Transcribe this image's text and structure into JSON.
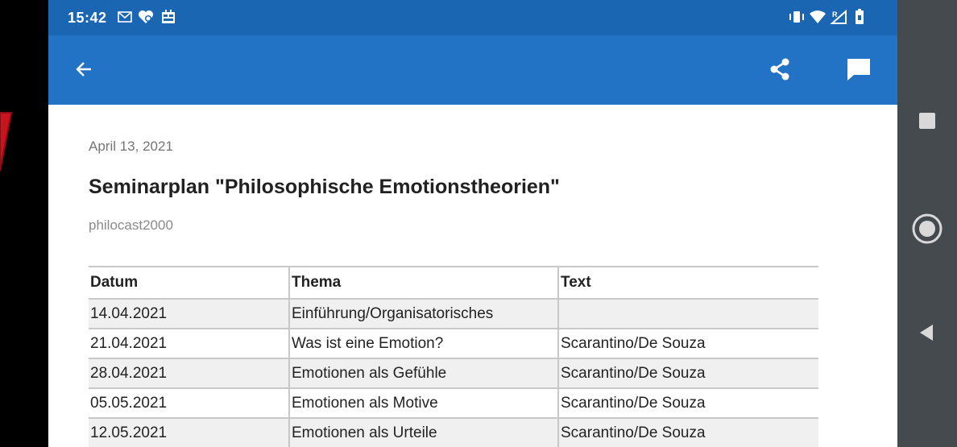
{
  "status_bar": {
    "time": "15:42",
    "left_icons": [
      "gmail-icon",
      "heart-notification-icon",
      "app-notification-icon"
    ],
    "right_icons": [
      "vibrate-icon",
      "wifi-icon",
      "signal-roaming-icon",
      "battery-icon"
    ]
  },
  "app_bar": {
    "back_icon": "arrow-left-icon",
    "share_icon": "share-icon",
    "comment_icon": "comment-icon",
    "color": "#2273c6"
  },
  "post": {
    "date": "April 13, 2021",
    "title": "Seminarplan \"Philosophische Emotionstheorien\"",
    "author": "philocast2000"
  },
  "table": {
    "headers": [
      "Datum",
      "Thema",
      "Text"
    ],
    "rows": [
      [
        "14.04.2021",
        "Einführung/Organisatorisches",
        ""
      ],
      [
        "21.04.2021",
        "Was ist eine Emotion?",
        "Scarantino/De Souza"
      ],
      [
        "28.04.2021",
        "Emotionen als Gefühle",
        "Scarantino/De Souza"
      ],
      [
        "05.05.2021",
        "Emotionen als Motive",
        "Scarantino/De Souza"
      ],
      [
        "12.05.2021",
        "Emotionen als Urteile",
        "Scarantino/De Souza"
      ]
    ]
  },
  "nav_bar": {
    "icons": [
      "recents-square-icon",
      "home-circle-icon",
      "back-triangle-icon"
    ]
  }
}
